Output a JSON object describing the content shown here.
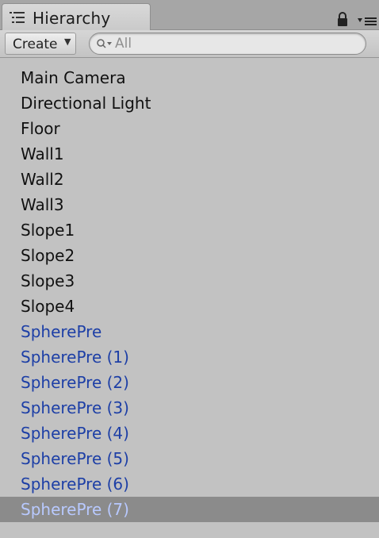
{
  "window": {
    "tab_title": "Hierarchy"
  },
  "toolbar": {
    "create_label": "Create",
    "create_caret": "▼",
    "search_placeholder": "All"
  },
  "items": [
    {
      "label": "Main Camera",
      "type": "object"
    },
    {
      "label": "Directional Light",
      "type": "object"
    },
    {
      "label": "Floor",
      "type": "object"
    },
    {
      "label": "Wall1",
      "type": "object"
    },
    {
      "label": "Wall2",
      "type": "object"
    },
    {
      "label": "Wall3",
      "type": "object"
    },
    {
      "label": "Slope1",
      "type": "object"
    },
    {
      "label": "Slope2",
      "type": "object"
    },
    {
      "label": "Slope3",
      "type": "object"
    },
    {
      "label": "Slope4",
      "type": "object"
    },
    {
      "label": "SpherePre",
      "type": "prefab"
    },
    {
      "label": "SpherePre (1)",
      "type": "prefab"
    },
    {
      "label": "SpherePre (2)",
      "type": "prefab"
    },
    {
      "label": "SpherePre (3)",
      "type": "prefab"
    },
    {
      "label": "SpherePre (4)",
      "type": "prefab"
    },
    {
      "label": "SpherePre (5)",
      "type": "prefab"
    },
    {
      "label": "SpherePre (6)",
      "type": "prefab"
    },
    {
      "label": "SpherePre (7)",
      "type": "prefab",
      "selected": true
    }
  ],
  "colors": {
    "panel_bg": "#c2c2c2",
    "prefab_text": "#1d3fa6",
    "selected_bg": "#8b8b8b",
    "selected_text": "#b8c9ff"
  },
  "icons": [
    "hierarchy-list-icon",
    "lock-icon",
    "panel-menu-icon",
    "search-icon"
  ]
}
